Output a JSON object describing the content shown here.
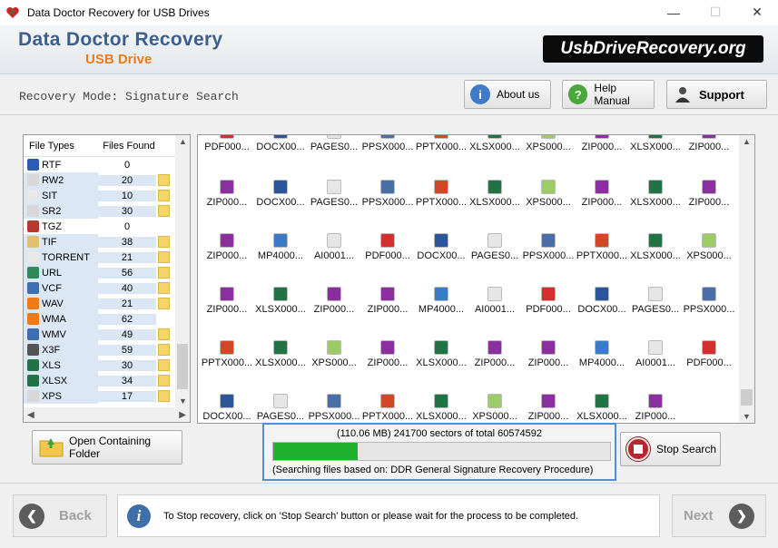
{
  "window": {
    "title": "Data Doctor Recovery for USB Drives",
    "minimize": "—",
    "maximize": "☐",
    "close": "✕"
  },
  "header": {
    "brand_main": "Data Doctor Recovery",
    "brand_sub": "USB Drive",
    "site": "UsbDriveRecovery.org"
  },
  "mode": {
    "label": "Recovery Mode: Signature Search"
  },
  "header_buttons": {
    "about": "About us",
    "help": "Help Manual",
    "support": "Support"
  },
  "file_types": {
    "col_type": "File Types",
    "col_found": "Files Found",
    "rows": [
      {
        "name": "RTF",
        "count": "0",
        "folder": false,
        "color": "#2a5db0"
      },
      {
        "name": "RW2",
        "count": "20",
        "folder": true,
        "color": "#d8d8d8"
      },
      {
        "name": "SIT",
        "count": "10",
        "folder": true,
        "color": "#e8e8e8"
      },
      {
        "name": "SR2",
        "count": "30",
        "folder": true,
        "color": "#d8d8d8"
      },
      {
        "name": "TGZ",
        "count": "0",
        "folder": false,
        "color": "#b33a2f"
      },
      {
        "name": "TIF",
        "count": "38",
        "folder": true,
        "color": "#e0c070"
      },
      {
        "name": "TORRENT",
        "count": "21",
        "folder": true,
        "color": "#e8e8e8"
      },
      {
        "name": "URL",
        "count": "56",
        "folder": true,
        "color": "#2e8b57"
      },
      {
        "name": "VCF",
        "count": "40",
        "folder": true,
        "color": "#3d6fb0"
      },
      {
        "name": "WAV",
        "count": "21",
        "folder": true,
        "color": "#f07a17"
      },
      {
        "name": "WMA",
        "count": "62",
        "folder": false,
        "color": "#f07a17"
      },
      {
        "name": "WMV",
        "count": "49",
        "folder": true,
        "color": "#3d6fb0"
      },
      {
        "name": "X3F",
        "count": "59",
        "folder": true,
        "color": "#555555"
      },
      {
        "name": "XLS",
        "count": "30",
        "folder": true,
        "color": "#217346"
      },
      {
        "name": "XLSX",
        "count": "34",
        "folder": true,
        "color": "#217346"
      },
      {
        "name": "XPS",
        "count": "17",
        "folder": true,
        "color": "#d8d8d8"
      }
    ]
  },
  "grid": {
    "rows": [
      [
        "PDF000...",
        "DOCX00...",
        "PAGES0...",
        "PPSX000...",
        "PPTX000...",
        "XLSX000...",
        "XPS000...",
        "ZIP000...",
        "XLSX000...",
        "ZIP000..."
      ],
      [
        "ZIP000...",
        "DOCX00...",
        "PAGES0...",
        "PPSX000...",
        "PPTX000...",
        "XLSX000...",
        "XPS000...",
        "ZIP000...",
        "XLSX000...",
        "ZIP000..."
      ],
      [
        "ZIP000...",
        "MP4000...",
        "AI0001...",
        "PDF000...",
        "DOCX00...",
        "PAGES0...",
        "PPSX000...",
        "PPTX000...",
        "XLSX000...",
        "XPS000..."
      ],
      [
        "ZIP000...",
        "XLSX000...",
        "ZIP000...",
        "ZIP000...",
        "MP4000...",
        "AI0001...",
        "PDF000...",
        "DOCX00...",
        "PAGES0...",
        "PPSX000..."
      ],
      [
        "PPTX000...",
        "XLSX000...",
        "XPS000...",
        "ZIP000...",
        "XLSX000...",
        "ZIP000...",
        "ZIP000...",
        "MP4000...",
        "AI0001...",
        "PDF000..."
      ],
      [
        "DOCX00...",
        "PAGES0...",
        "PPSX000...",
        "PPTX000...",
        "XLSX000...",
        "XPS000...",
        "ZIP000...",
        "XLSX000...",
        "ZIP000..."
      ]
    ]
  },
  "buttons": {
    "open_folder": "Open Containing Folder",
    "stop": "Stop Search"
  },
  "progress": {
    "text": "(110.06 MB) 241700  sectors  of  total 60574592",
    "fraction": 0.25,
    "note": "(Searching files based on:  DDR General Signature Recovery Procedure)"
  },
  "footer": {
    "back": "Back",
    "next": "Next",
    "info": "To Stop recovery, click on 'Stop Search' button or please wait for the process to be completed."
  }
}
